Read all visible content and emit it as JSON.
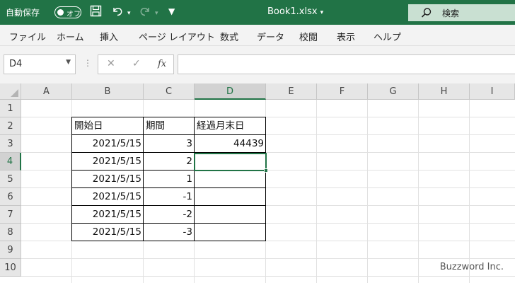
{
  "titlebar": {
    "autosave_label": "自動保存",
    "toggle_label": "オフ",
    "doc_title": "Book1.xlsx",
    "search_label": "検索"
  },
  "ribbon": {
    "tabs": [
      "ファイル",
      "ホーム",
      "挿入",
      "ページ レイアウト",
      "数式",
      "データ",
      "校閲",
      "表示",
      "ヘルプ"
    ]
  },
  "formula_bar": {
    "name_box": "D4",
    "fx_label": "fx",
    "formula": ""
  },
  "sheet": {
    "columns": [
      "A",
      "B",
      "C",
      "D",
      "E",
      "F",
      "G",
      "H",
      "I"
    ],
    "selected_column": "D",
    "rows": [
      "1",
      "2",
      "3",
      "4",
      "5",
      "6",
      "7",
      "8",
      "9",
      "10"
    ],
    "selected_row": "4",
    "headers": {
      "b2": "開始日",
      "c2": "期間",
      "d2": "経過月末日"
    },
    "b": [
      "2021/5/15",
      "2021/5/15",
      "2021/5/15",
      "2021/5/15",
      "2021/5/15",
      "2021/5/15"
    ],
    "c": [
      "3",
      "2",
      "1",
      "-1",
      "-2",
      "-3"
    ],
    "d3": "44439"
  },
  "watermark": "Buzzword Inc.",
  "colors": {
    "accent": "#217346",
    "ribbon": "#f3f3f3",
    "header": "#e6e6e6"
  }
}
